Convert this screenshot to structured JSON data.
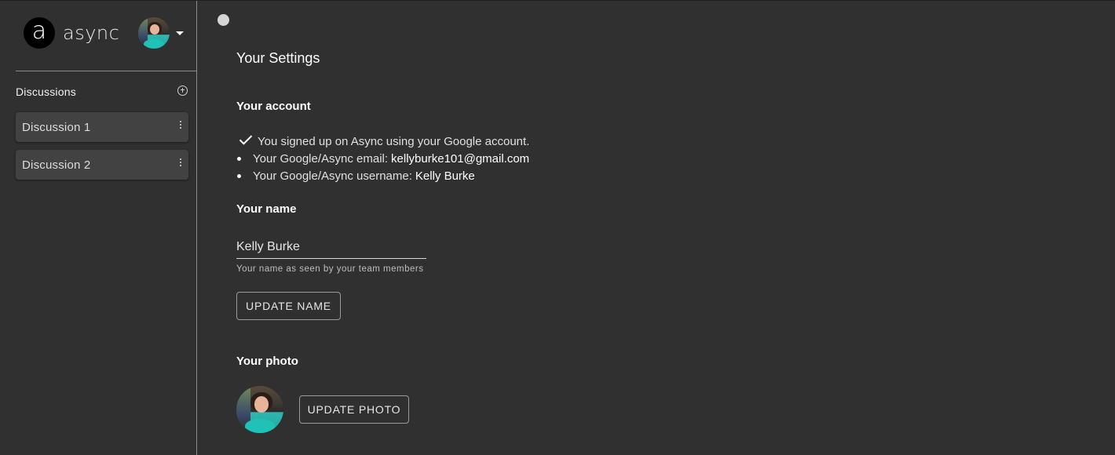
{
  "brand": {
    "logo_letter": "a",
    "name": "async"
  },
  "user_menu": {
    "avatar_icon": "user-avatar",
    "caret_icon": "caret-down-icon"
  },
  "sidebar": {
    "section_title": "Discussions",
    "add_icon": "add-circle-icon",
    "discussions": [
      {
        "label": "Discussion 1",
        "menu_icon": "more-vert-icon"
      },
      {
        "label": "Discussion 2",
        "menu_icon": "more-vert-icon"
      }
    ]
  },
  "main": {
    "status_icon": "status-dot",
    "title": "Your Settings",
    "account": {
      "heading": "Your account",
      "signup_note": "You signed up on Async using your Google account.",
      "email_label": "Your Google/Async email:",
      "email_value": "kellyburke101@gmail.com",
      "username_label": "Your Google/Async username:",
      "username_value": "Kelly Burke"
    },
    "name": {
      "heading": "Your name",
      "input_value": "Kelly Burke",
      "helper_text": "Your name as seen by your team members",
      "button_label": "UPDATE NAME"
    },
    "photo": {
      "heading": "Your photo",
      "button_label": "UPDATE PHOTO"
    }
  }
}
